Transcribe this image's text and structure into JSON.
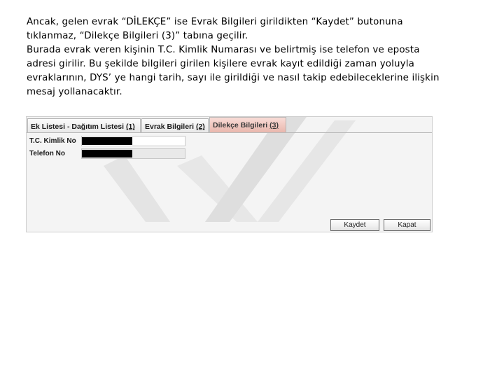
{
  "paragraph": {
    "lines": [
      "Ancak, gelen evrak “DİLEKÇE” ise Evrak Bilgileri girildikten “Kaydet” butonuna",
      "tıklanmaz, “Dilekçe Bilgileri (3)” tabına geçilir.",
      "Burada evrak veren kişinin T.C. Kimlik Numarası ve belirtmiş ise telefon ve eposta",
      "adresi girilir. Bu şekilde bilgileri girilen kişilere evrak kayıt edildiği zaman yoluyla",
      "evraklarının, DYS’ ye hangi tarih, sayı ile girildiği ve nasıl takip edebileceklerine ilişkin",
      "mesaj yollanacaktır."
    ]
  },
  "screenshot": {
    "tabs": [
      {
        "label": "Ek Listesi - Dağıtım Listesi",
        "num": "(1)"
      },
      {
        "label": "Evrak Bilgileri",
        "num": "(2)"
      },
      {
        "label": "Dilekçe Bilgileri",
        "num": "(3)"
      }
    ],
    "fields": [
      {
        "label": "T.C. Kimlik No"
      },
      {
        "label": "Telefon No"
      }
    ],
    "buttons": {
      "save": "Kaydet",
      "cancel": "Kapat"
    },
    "active_tab_color": "#e9b7ad",
    "redaction_color": "#000000"
  }
}
